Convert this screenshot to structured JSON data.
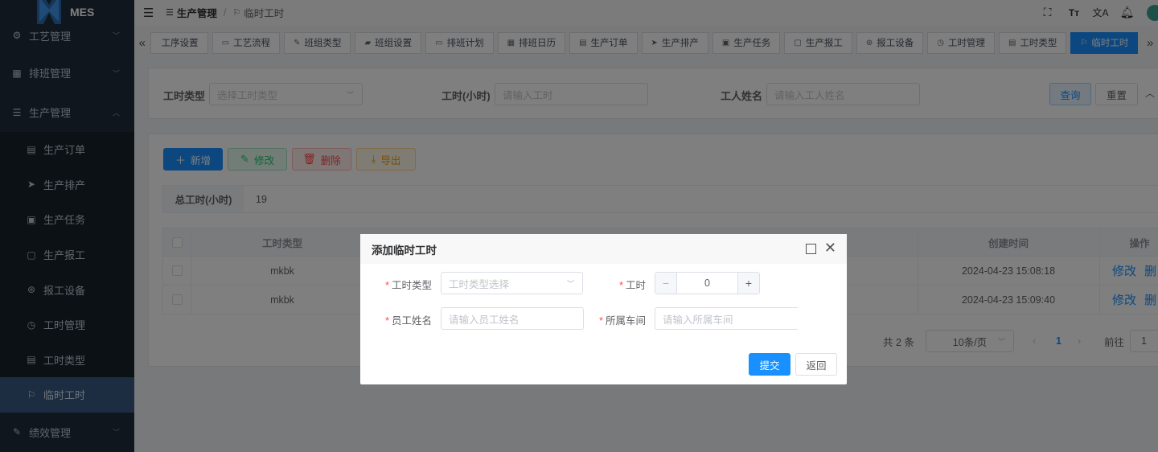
{
  "app": {
    "logo_text": "MES"
  },
  "sidebar": {
    "items": [
      {
        "label": "工艺管理",
        "icon": "process-icon"
      },
      {
        "label": "排班管理",
        "icon": "calendar-icon"
      },
      {
        "label": "生产管理",
        "icon": "database-icon"
      }
    ],
    "sub_items": [
      {
        "label": "生产订单",
        "icon": "clipboard-icon"
      },
      {
        "label": "生产排产",
        "icon": "send-icon"
      },
      {
        "label": "生产任务",
        "icon": "task-icon"
      },
      {
        "label": "生产报工",
        "icon": "report-icon"
      },
      {
        "label": "报工设备",
        "icon": "device-icon"
      },
      {
        "label": "工时管理",
        "icon": "clock-icon"
      },
      {
        "label": "工时类型",
        "icon": "list-icon"
      },
      {
        "label": "临时工时",
        "icon": "flag-icon"
      }
    ],
    "bottom_item": {
      "label": "绩效管理",
      "icon": "edit-icon"
    }
  },
  "header": {
    "breadcrumb_parent": "生产管理",
    "breadcrumb_sep": "/",
    "breadcrumb_current": "临时工时"
  },
  "tags": [
    "工序设置",
    "工艺流程",
    "班组类型",
    "班组设置",
    "排班计划",
    "排班日历",
    "生产订单",
    "生产排产",
    "生产任务",
    "生产报工",
    "报工设备",
    "工时管理",
    "工时类型",
    "临时工时"
  ],
  "search": {
    "type_label": "工时类型",
    "type_placeholder": "选择工时类型",
    "hours_label": "工时(小时)",
    "hours_placeholder": "请输入工时",
    "name_label": "工人姓名",
    "name_placeholder": "请输入工人姓名",
    "query_btn": "查询",
    "reset_btn": "重置"
  },
  "toolbar": {
    "add_btn": "新增",
    "edit_btn": "修改",
    "delete_btn": "删除",
    "export_btn": "导出"
  },
  "summary": {
    "label": "总工时(小时)",
    "value": "19"
  },
  "table": {
    "headers": {
      "type": "工时类型",
      "created": "创建时间",
      "action": "操作"
    },
    "rows": [
      {
        "type": "mkbk",
        "created": "2024-04-23 15:08:18",
        "edit": "修改",
        "delete": "删"
      },
      {
        "type": "mkbk",
        "created": "2024-04-23 15:09:40",
        "edit": "修改",
        "delete": "删"
      }
    ]
  },
  "pagination": {
    "total": "共 2 条",
    "page_size": "10条/页",
    "current_page": "1",
    "goto_label": "前往",
    "goto_value": "1"
  },
  "dialog": {
    "title": "添加临时工时",
    "type_label": "工时类型",
    "type_placeholder": "工时类型选择",
    "hours_label": "工时",
    "hours_value": "0",
    "name_label": "员工姓名",
    "name_placeholder": "请输入员工姓名",
    "workshop_label": "所属车间",
    "workshop_placeholder": "请输入所属车间",
    "submit_btn": "提交",
    "back_btn": "返回"
  },
  "colors": {
    "primary": "#1890ff",
    "sidebar_bg": "#1f2d3d",
    "active_menu": "#3a5a82"
  }
}
